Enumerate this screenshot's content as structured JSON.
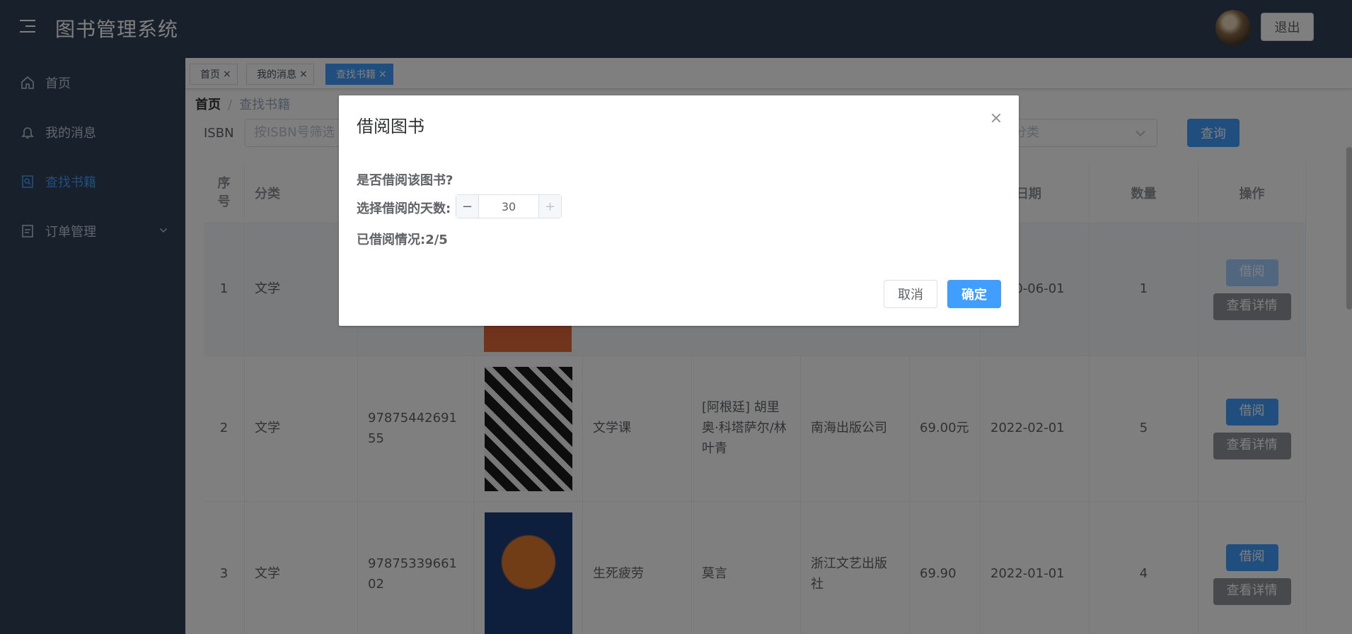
{
  "header": {
    "title": "图书管理系统",
    "logout_label": "退出"
  },
  "sidebar": {
    "items": [
      {
        "label": "首页",
        "icon": "home-icon"
      },
      {
        "label": "我的消息",
        "icon": "bell-icon"
      },
      {
        "label": "查找书籍",
        "icon": "book-icon",
        "active": true
      },
      {
        "label": "订单管理",
        "icon": "document-icon",
        "expandable": true
      }
    ]
  },
  "tags": [
    {
      "label": "首页"
    },
    {
      "label": "我的消息"
    },
    {
      "label": "查找书籍",
      "active": true
    }
  ],
  "breadcrumb": {
    "root": "首页",
    "current": "查找书籍"
  },
  "filters": {
    "isbn_label": "ISBN",
    "isbn_placeholder": "按ISBN号筛选",
    "category_placeholder": "书分类",
    "query_label": "查询"
  },
  "table": {
    "headers": [
      "序号",
      "分类",
      "",
      "",
      "",
      "",
      "",
      "",
      "出版日期",
      "数量",
      "操作"
    ],
    "rows": [
      {
        "index": "1",
        "category": "文学",
        "isbn": "",
        "title": "",
        "author": "",
        "publisher": "",
        "price": "",
        "date": "2020-06-01",
        "count": "1"
      },
      {
        "index": "2",
        "category": "文学",
        "isbn": "9787544269155",
        "title": "文学课",
        "author": "[阿根廷] 胡里奥·科塔萨尔/林叶青",
        "publisher": "南海出版公司",
        "price": "69.00元",
        "date": "2022-02-01",
        "count": "5"
      },
      {
        "index": "3",
        "category": "文学",
        "isbn": "9787533966102",
        "title": "生死疲劳",
        "author": "莫言",
        "publisher": "浙江文艺出版社",
        "price": "69.90",
        "date": "2022-01-01",
        "count": "4"
      }
    ],
    "borrow_label": "借阅",
    "detail_label": "查看详情"
  },
  "dialog": {
    "title": "借阅图书",
    "question": "是否借阅该图书?",
    "days_label": "选择借阅的天数:",
    "days_value": "30",
    "status_label": "已借阅情况:2/5",
    "cancel_label": "取消",
    "ok_label": "确定"
  },
  "colors": {
    "sidebar_bg": "#304156",
    "primary": "#409eff",
    "sidebar_text": "#bfcbd9"
  }
}
